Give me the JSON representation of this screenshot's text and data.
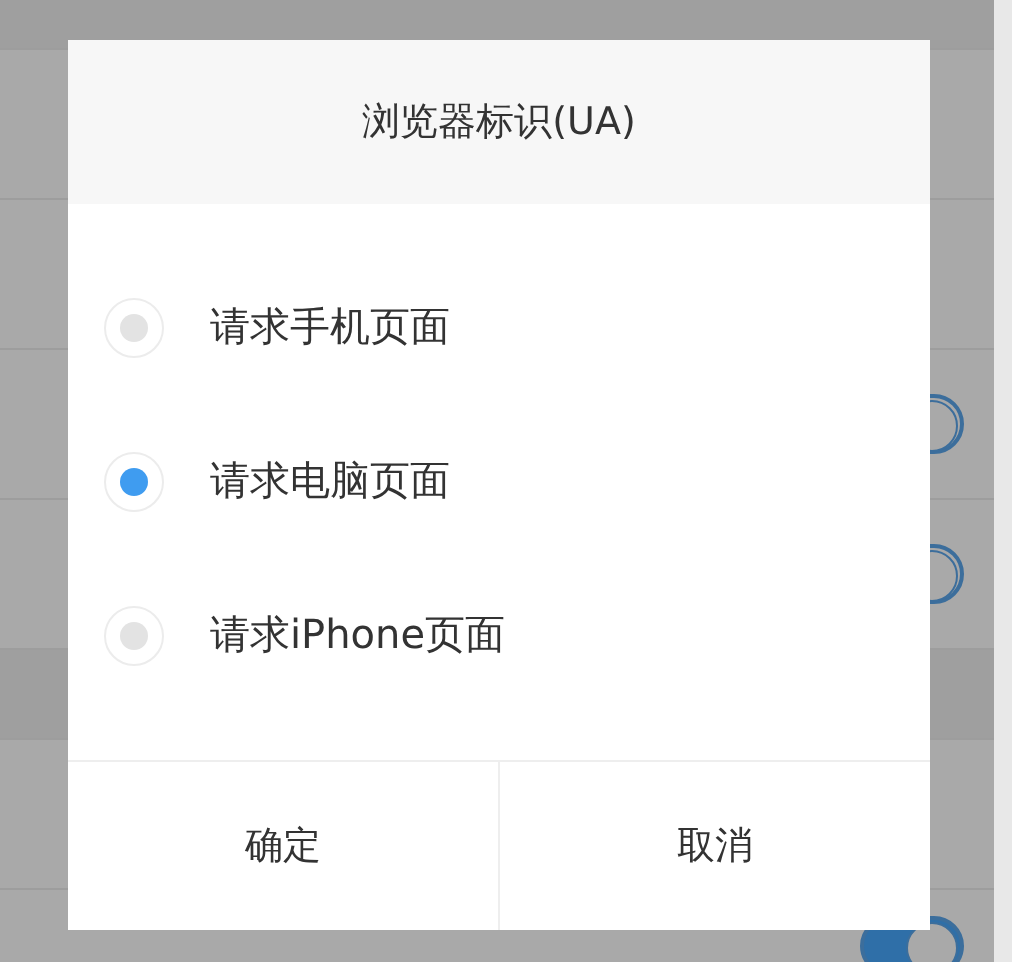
{
  "settings": [
    {
      "kind": "header"
    },
    {
      "kind": "row"
    },
    {
      "kind": "row"
    },
    {
      "kind": "toggle",
      "on": true
    },
    {
      "kind": "toggle",
      "on": true
    },
    {
      "kind": "header"
    },
    {
      "kind": "row"
    },
    {
      "kind": "toggle",
      "on": true
    }
  ],
  "dialog": {
    "title": "浏览器标识(UA)",
    "options": [
      {
        "label": "请求手机页面",
        "selected": false
      },
      {
        "label": "请求电脑页面",
        "selected": true
      },
      {
        "label": "请求iPhone页面",
        "selected": false
      }
    ],
    "buttons": [
      "确定",
      "取消"
    ]
  }
}
